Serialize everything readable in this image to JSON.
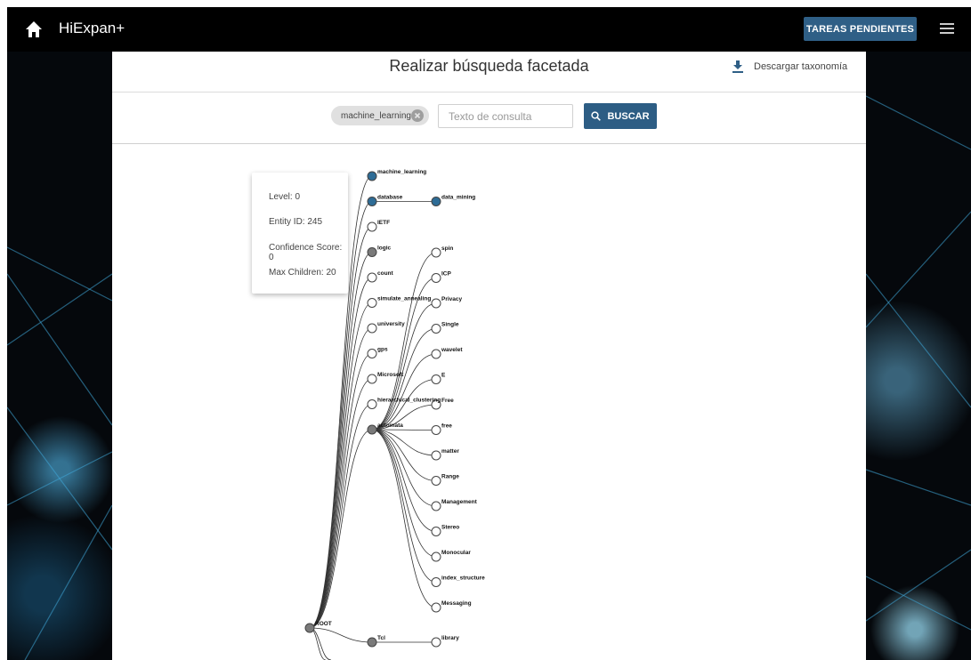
{
  "app": {
    "title": "HiExpan+",
    "tasks_button": "TAREAS PENDIENTES"
  },
  "page": {
    "title": "Realizar búsqueda facetada",
    "download_label": "Descargar taxonomía"
  },
  "search": {
    "chip": "machine_learning",
    "query_placeholder": "Texto de consulta",
    "query_value": "",
    "button_label": "BUSCAR"
  },
  "tooltip": {
    "level": "Level: 0",
    "entity_id": "Entity ID: 245",
    "confidence": "Confidence Score: 0",
    "max_children": "Max Children: 20"
  },
  "colors": {
    "accent": "#2f5f86",
    "node_blue": "#2e6c96",
    "node_gray": "#7a7a7a"
  },
  "icons": {
    "home": "home-icon",
    "menu": "hamburger-menu-icon",
    "download": "download-icon",
    "search": "search-icon",
    "chip_close": "close-circle-icon"
  },
  "tree": {
    "root": "ROOT",
    "nodes": [
      {
        "label": "machine_learning",
        "fill": "blue"
      },
      {
        "label": "database",
        "fill": "blue",
        "children": [
          {
            "label": "data_mining",
            "fill": "blue"
          }
        ]
      },
      {
        "label": "IETF",
        "fill": "empty"
      },
      {
        "label": "logic",
        "fill": "gray"
      },
      {
        "label": "count",
        "fill": "empty"
      },
      {
        "label": "simulate_annealing",
        "fill": "empty"
      },
      {
        "label": "university",
        "fill": "empty"
      },
      {
        "label": "gps",
        "fill": "empty"
      },
      {
        "label": "Microsoft",
        "fill": "empty"
      },
      {
        "label": "hierarchical_clustering",
        "fill": "empty"
      },
      {
        "label": "automata",
        "fill": "gray",
        "children": [
          {
            "label": "spin",
            "fill": "empty"
          },
          {
            "label": "ICP",
            "fill": "empty"
          },
          {
            "label": "Privacy",
            "fill": "empty"
          },
          {
            "label": "Single",
            "fill": "empty"
          },
          {
            "label": "wavelet",
            "fill": "empty"
          },
          {
            "label": "E",
            "fill": "empty"
          },
          {
            "label": "Free",
            "fill": "empty"
          },
          {
            "label": "free",
            "fill": "empty"
          },
          {
            "label": "matter",
            "fill": "empty"
          },
          {
            "label": "Range",
            "fill": "empty"
          },
          {
            "label": "Management",
            "fill": "empty"
          },
          {
            "label": "Stereo",
            "fill": "empty"
          },
          {
            "label": "Monocular",
            "fill": "empty"
          },
          {
            "label": "index_structure",
            "fill": "empty"
          },
          {
            "label": "Messaging",
            "fill": "empty"
          }
        ]
      },
      {
        "label": "Tcl",
        "fill": "gray",
        "children": [
          {
            "label": "library",
            "fill": "empty"
          }
        ]
      }
    ]
  }
}
